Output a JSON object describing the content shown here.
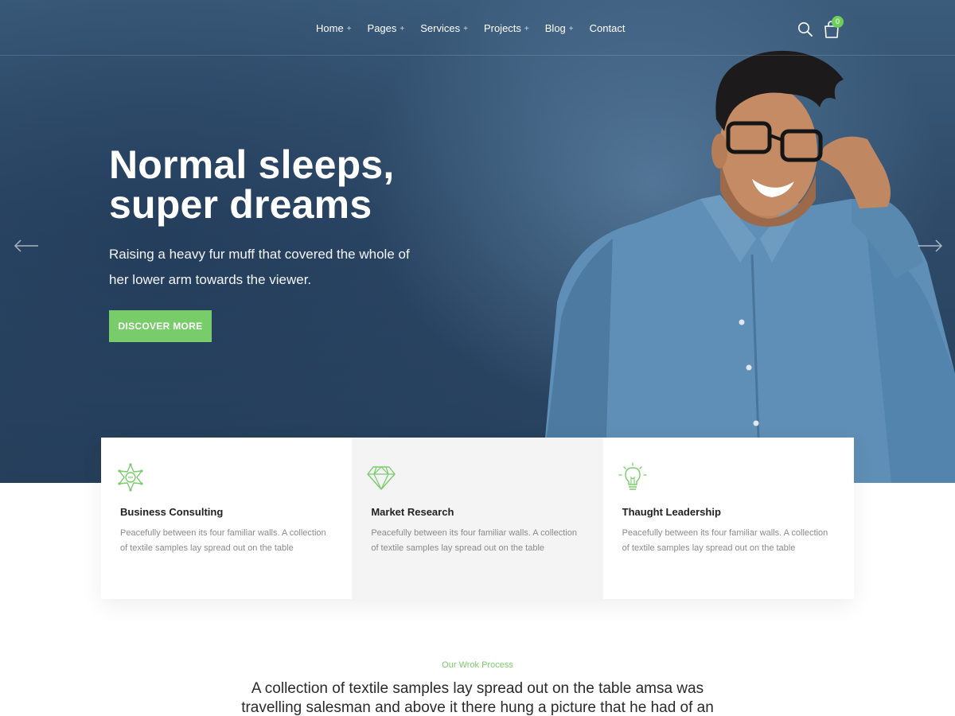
{
  "nav": {
    "items": [
      {
        "label": "Home",
        "has_submenu": true
      },
      {
        "label": "Pages",
        "has_submenu": true
      },
      {
        "label": "Services",
        "has_submenu": true
      },
      {
        "label": "Projects",
        "has_submenu": true
      },
      {
        "label": "Blog",
        "has_submenu": true
      },
      {
        "label": "Contact",
        "has_submenu": false
      }
    ],
    "submenu_indicator": "+",
    "cart_count": "0",
    "search_icon": "search-icon",
    "cart_icon": "shopping-bag-icon"
  },
  "hero": {
    "title_line1": "Normal sleeps,",
    "title_line2": "super dreams",
    "subtitle": "Raising a heavy fur muff that covered the whole of her lower arm towards the viewer.",
    "button_label": "DISCOVER MORE",
    "prev_icon": "arrow-left-icon",
    "next_icon": "arrow-right-icon"
  },
  "services": [
    {
      "icon": "sheriff-badge-icon",
      "title": "Business Consulting",
      "description": "Peacefully between its four familiar walls. A collection of textile samples lay spread out on the table"
    },
    {
      "icon": "diamond-icon",
      "title": "Market Research",
      "description": "Peacefully between its four familiar walls. A collection of textile samples lay spread out on the table"
    },
    {
      "icon": "lightbulb-icon",
      "title": "Thaught Leadership",
      "description": "Peacefully between its four familiar walls. A collection of textile samples lay spread out on the table"
    }
  ],
  "process": {
    "tagline": "Our Wrok Process",
    "text": "A collection of textile samples lay spread out on the table amsa was travelling salesman and above it there hung a picture that he had of an"
  },
  "colors": {
    "accent": "#79cc6a",
    "hero_bg": "#2e4a68",
    "card_alt_bg": "#f4f4f4"
  }
}
